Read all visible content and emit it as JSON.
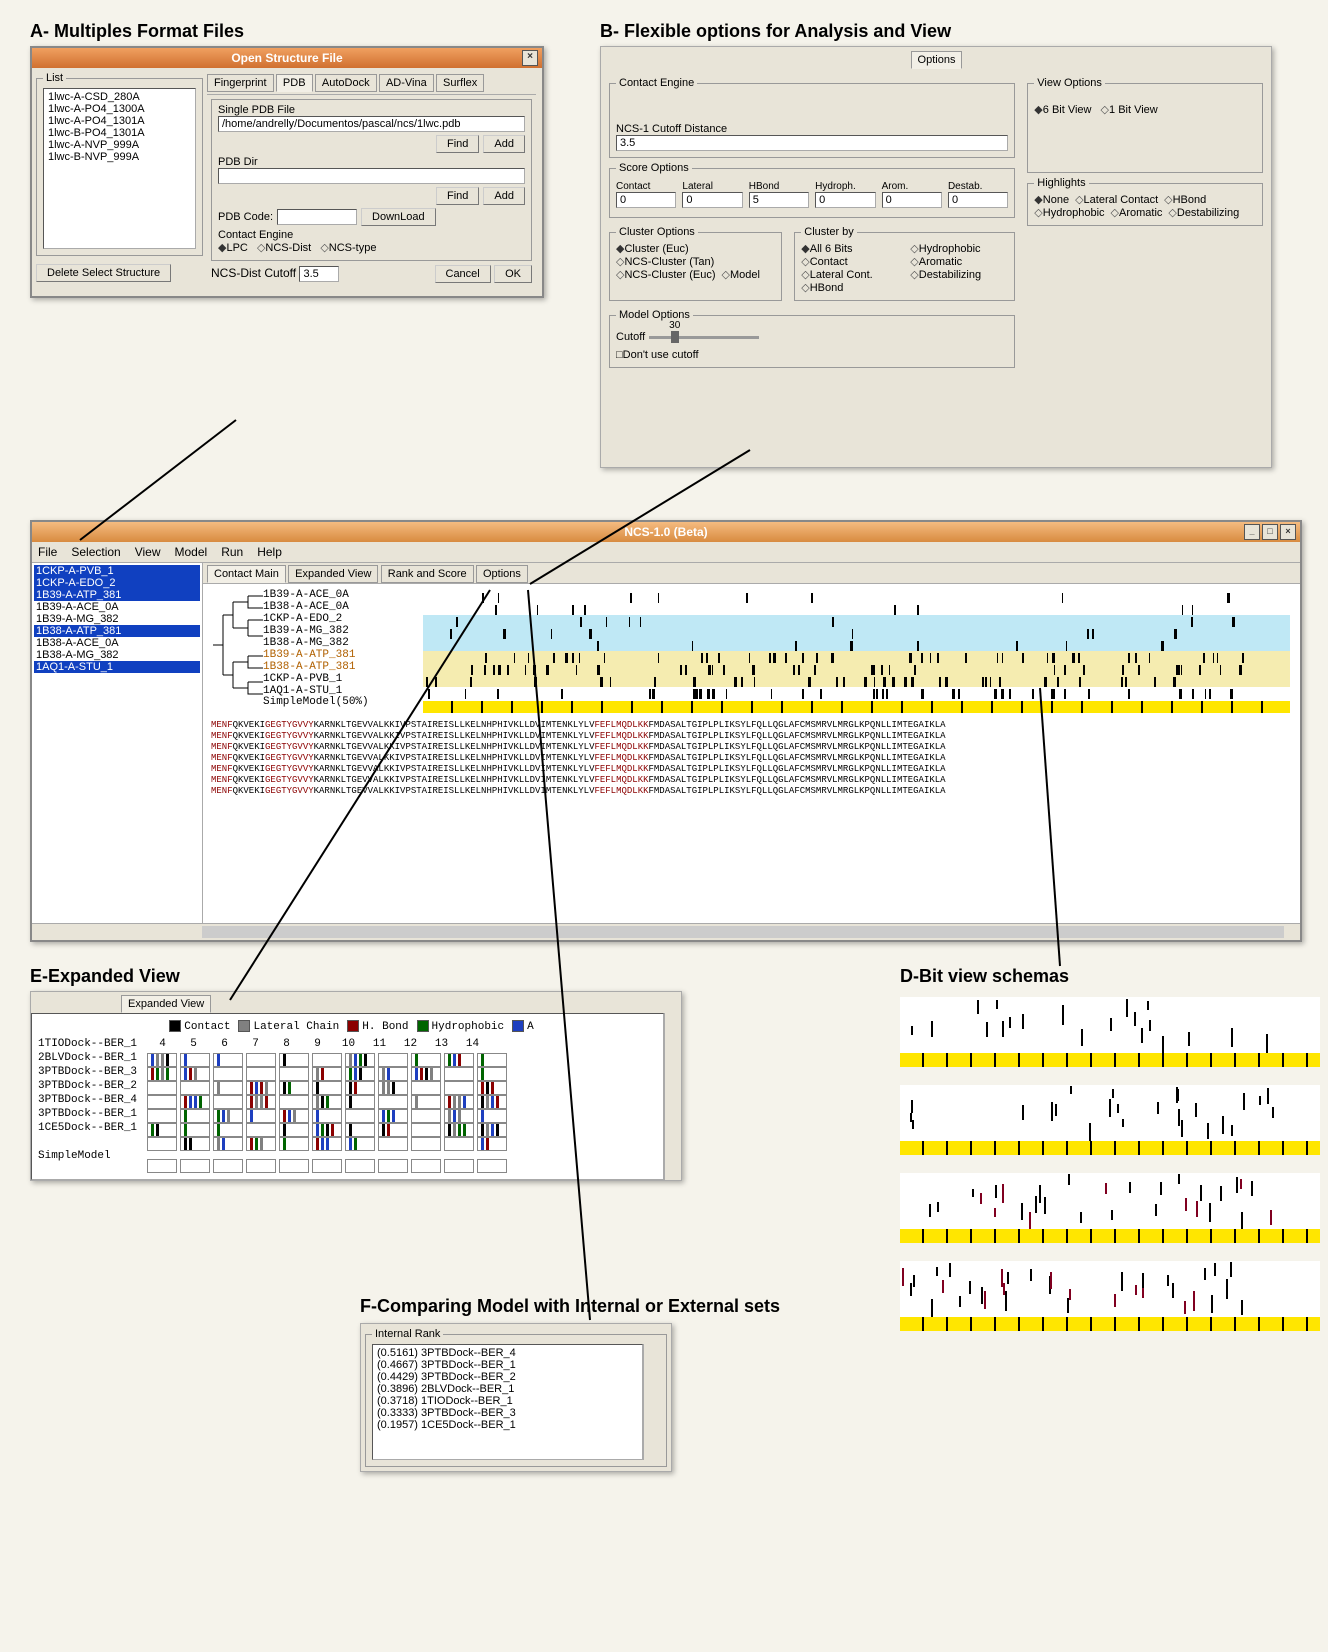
{
  "labels": {
    "A": "A- Multiples Format Files",
    "B": "B- Flexible options for Analysis and View",
    "C_title": "NCS-1.0 (Beta)",
    "D": "D-Bit view schemas",
    "E": "E-Expanded View",
    "F": "F-Comparing Model with Internal or External sets"
  },
  "panelA": {
    "title": "Open Structure File",
    "list_label": "List",
    "list": [
      "1lwc-A-CSD_280A",
      "1lwc-A-PO4_1300A",
      "1lwc-A-PO4_1301A",
      "1lwc-B-PO4_1301A",
      "1lwc-A-NVP_999A",
      "1lwc-B-NVP_999A"
    ],
    "tabs": [
      "Fingerprint",
      "PDB",
      "AutoDock",
      "AD-Vina",
      "Surflex"
    ],
    "single_label": "Single PDB File",
    "single_value": "/home/andrelly/Documentos/pascal/ncs/1lwc.pdb",
    "find": "Find",
    "add": "Add",
    "pdbdir_label": "PDB Dir",
    "pdbdir_value": "",
    "pdbcode_label": "PDB Code:",
    "pdbcode_value": "",
    "download": "DownLoad",
    "engine_label": "Contact Engine",
    "engines": {
      "lpc": "LPC",
      "ncsdist": "NCS-Dist",
      "ncstype": "NCS-type"
    },
    "cutoff_label": "NCS-Dist Cutoff",
    "cutoff_value": "3.5",
    "delete": "Delete Select Structure",
    "cancel": "Cancel",
    "ok": "OK"
  },
  "panelB": {
    "options_tab": "Options",
    "engine_legend": "Contact Engine",
    "cutoff_label": "NCS-1 Cutoff Distance",
    "cutoff_value": "3.5",
    "score_legend": "Score Options",
    "score_fields": {
      "Contact": "0",
      "Lateral": "0",
      "HBond": "5",
      "Hydroph.": "0",
      "Arom.": "0",
      "Destab.": "0"
    },
    "cluster_legend": "Cluster Options",
    "cluster_opts": [
      "Cluster (Euc)",
      "NCS-Cluster (Tan)",
      "NCS-Cluster (Euc)",
      "Model"
    ],
    "clusterby_legend": "Cluster by",
    "clusterby_opts": [
      "All 6 Bits",
      "Contact",
      "Lateral Cont.",
      "HBond",
      "Hydrophobic",
      "Aromatic",
      "Destabilizing"
    ],
    "model_legend": "Model Options",
    "model_cutoff_label": "Cutoff",
    "model_cutoff_value": "30",
    "model_check": "Don't use cutoff",
    "view_legend": "View Options",
    "view_6": "6 Bit View",
    "view_1": "1 Bit View",
    "hl_legend": "Highlights",
    "hl_opts": [
      "None",
      "Lateral Contact",
      "HBond",
      "Hydrophobic",
      "Aromatic",
      "Destabilizing"
    ]
  },
  "panelC": {
    "menus": [
      "File",
      "Selection",
      "View",
      "Model",
      "Run",
      "Help"
    ],
    "tabs": [
      "Contact Main",
      "Expanded View",
      "Rank and Score",
      "Options"
    ],
    "sidebar": [
      {
        "t": "1CKP-A-PVB_1",
        "hl": true
      },
      {
        "t": "1CKP-A-EDO_2",
        "hl": true
      },
      {
        "t": "1B39-A-ATP_381",
        "hl": true
      },
      {
        "t": "1B39-A-ACE_0A",
        "hl": false
      },
      {
        "t": "1B39-A-MG_382",
        "hl": false
      },
      {
        "t": "1B38-A-ATP_381",
        "hl": true
      },
      {
        "t": "1B38-A-ACE_0A",
        "hl": false
      },
      {
        "t": "1B38-A-MG_382",
        "hl": false
      },
      {
        "t": "1AQ1-A-STU_1",
        "hl": true
      }
    ],
    "tree_names": [
      "1B39-A-ACE_0A",
      "1B38-A-ACE_0A",
      "1CKP-A-EDO_2",
      "1B39-A-MG_382",
      "1B38-A-MG_382",
      "1B39-A-ATP_381",
      "1B38-A-ATP_381",
      "1CKP-A-PVB_1",
      "1AQ1-A-STU_1"
    ],
    "simplemodel": "SimpleModel(50%)",
    "seq_plain": "QKVEKIGEGTYGVVYKARNKLTGEVVALKKIVPSTAIREISLLKELNHPHIVKLLDVIMTENKLYLVFEFLMQDLKKFMDASALTGIPLPLIKSYLFQLLQGLAFCMSMRVLMRGLKPQNLLIMTEGAIKLA",
    "seq_prefix": "MENF"
  },
  "panelE": {
    "tab": "Expanded View",
    "legend": {
      "Contact": "#000",
      "Lateral Chain": "#808080",
      "H. Bond": "#8b0000",
      "Hydrophobic": "#006400",
      "A": "#1e3fbf"
    },
    "cols": [
      "4",
      "5",
      "6",
      "7",
      "8",
      "9",
      "10",
      "11",
      "12",
      "13",
      "14"
    ],
    "rows": [
      "1TIODock--BER_1",
      "2BLVDock--BER_1",
      "3PTBDock--BER_3",
      "3PTBDock--BER_2",
      "3PTBDock--BER_4",
      "3PTBDock--BER_1",
      "1CE5Dock--BER_1"
    ],
    "simplemodel": "SimpleModel"
  },
  "panelF": {
    "legend": "Internal Rank",
    "items": [
      "(0.5161) 3PTBDock--BER_4",
      "(0.4667) 3PTBDock--BER_1",
      "(0.4429) 3PTBDock--BER_2",
      "(0.3896) 2BLVDock--BER_1",
      "(0.3718) 1TIODock--BER_1",
      "(0.3333) 3PTBDock--BER_3",
      "(0.1957) 1CE5Dock--BER_1"
    ]
  }
}
